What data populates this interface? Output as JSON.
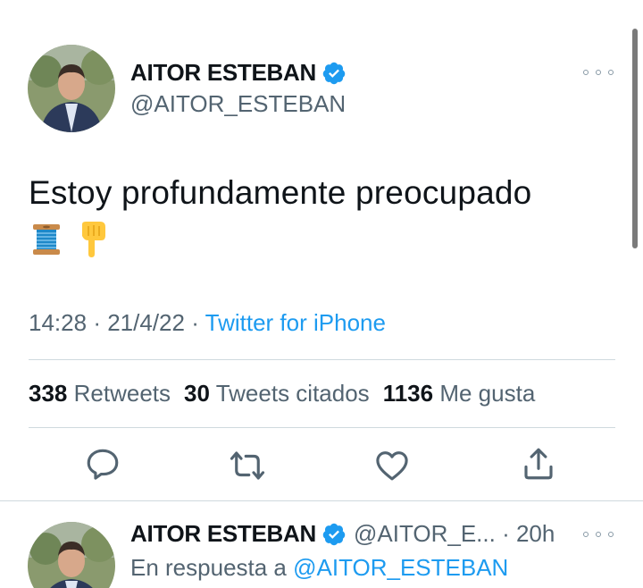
{
  "tweet": {
    "author_name": "AITOR ESTEBAN",
    "author_handle": "@AITOR_ESTEBAN",
    "text": "Estoy profundamente preocupado",
    "emojis": [
      "spool-of-thread-emoji",
      "pointing-down-hand-emoji"
    ],
    "time": "14:28",
    "date": "21/4/22",
    "separator": "·",
    "source": "Twitter for iPhone"
  },
  "stats": {
    "retweets_count": "338",
    "retweets_label": "Retweets",
    "quotes_count": "30",
    "quotes_label": "Tweets citados",
    "likes_count": "1136",
    "likes_label": "Me gusta"
  },
  "actions": [
    "reply-icon",
    "retweet-icon",
    "like-icon",
    "share-icon"
  ],
  "reply_tweet": {
    "author_name": "AITOR ESTEBAN",
    "author_handle": "@AITOR_E...",
    "separator": "·",
    "age": "20h",
    "reply_prefix": "En respuesta a",
    "reply_to": "@AITOR_ESTEBAN"
  },
  "colors": {
    "accent": "#1d9bf0",
    "text": "#0f1419",
    "secondary": "#536471",
    "divider": "#cfd9de"
  }
}
